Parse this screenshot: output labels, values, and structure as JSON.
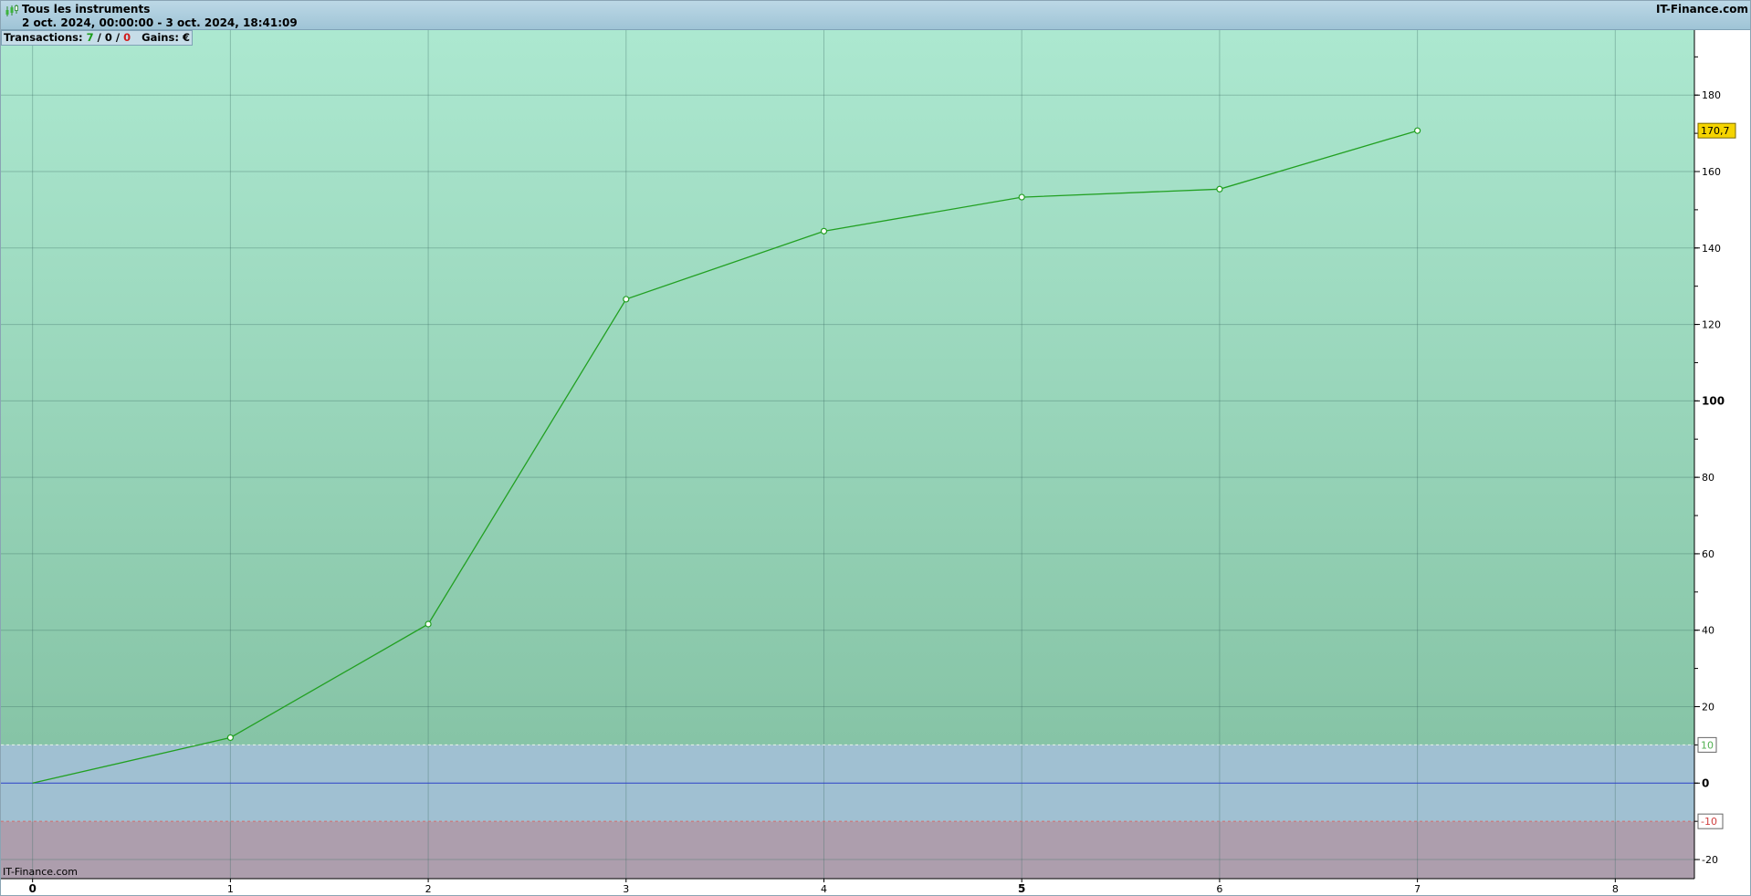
{
  "header": {
    "title": "Tous les instruments",
    "range": "2 oct. 2024, 00:00:00 - 3 oct. 2024, 18:41:09",
    "brand": "IT-Finance.com",
    "icon": "candlestick-chart-icon"
  },
  "stats": {
    "label": "Transactions:",
    "total": "7",
    "sep1": "/",
    "neutral": "0",
    "sep2": "/",
    "losing": "0",
    "gains_label": "Gains:",
    "currency": "€"
  },
  "footer": {
    "brand": "IT-Finance.com"
  },
  "colors": {
    "line": "#22a022",
    "zero_line": "#2a40c8",
    "upper_zone_top": "#ace8d0",
    "upper_zone_bottom": "#86c4a6",
    "neutral_zone": "#a0c0d2",
    "lower_zone": "#ad9ead",
    "last_value_badge": "#f5d400",
    "upper_threshold": "#50b050",
    "lower_threshold": "#d04040"
  },
  "chart_data": {
    "type": "line",
    "x": [
      0,
      1,
      2,
      3,
      4,
      5,
      6,
      7
    ],
    "values": [
      0,
      11.9,
      41.6,
      126.6,
      144.4,
      153.3,
      155.4,
      170.7
    ],
    "xlim": [
      -0.16,
      8.4
    ],
    "ylim": [
      -25,
      197
    ],
    "x_ticks": [
      {
        "value": 0,
        "label": "0",
        "bold": true
      },
      {
        "value": 1,
        "label": "1",
        "bold": false
      },
      {
        "value": 2,
        "label": "2",
        "bold": false
      },
      {
        "value": 3,
        "label": "3",
        "bold": false
      },
      {
        "value": 4,
        "label": "4",
        "bold": false
      },
      {
        "value": 5,
        "label": "5",
        "bold": true
      },
      {
        "value": 6,
        "label": "6",
        "bold": false
      },
      {
        "value": 7,
        "label": "7",
        "bold": false
      },
      {
        "value": 8,
        "label": "8",
        "bold": false
      }
    ],
    "y_ticks": [
      {
        "value": -20,
        "label": "-20",
        "bold": false
      },
      {
        "value": 0,
        "label": "0",
        "bold": true
      },
      {
        "value": 20,
        "label": "20",
        "bold": false
      },
      {
        "value": 40,
        "label": "40",
        "bold": false
      },
      {
        "value": 60,
        "label": "60",
        "bold": false
      },
      {
        "value": 80,
        "label": "80",
        "bold": false
      },
      {
        "value": 100,
        "label": "100",
        "bold": true
      },
      {
        "value": 120,
        "label": "120",
        "bold": false
      },
      {
        "value": 140,
        "label": "140",
        "bold": false
      },
      {
        "value": 160,
        "label": "160",
        "bold": false
      },
      {
        "value": 180,
        "label": "180",
        "bold": false
      }
    ],
    "upper_threshold": {
      "value": 10,
      "label": "10"
    },
    "lower_threshold": {
      "value": -10,
      "label": "-10"
    },
    "last_value": {
      "value": 170.7,
      "label": "170,7"
    },
    "grid": true,
    "axis_position": "right"
  }
}
